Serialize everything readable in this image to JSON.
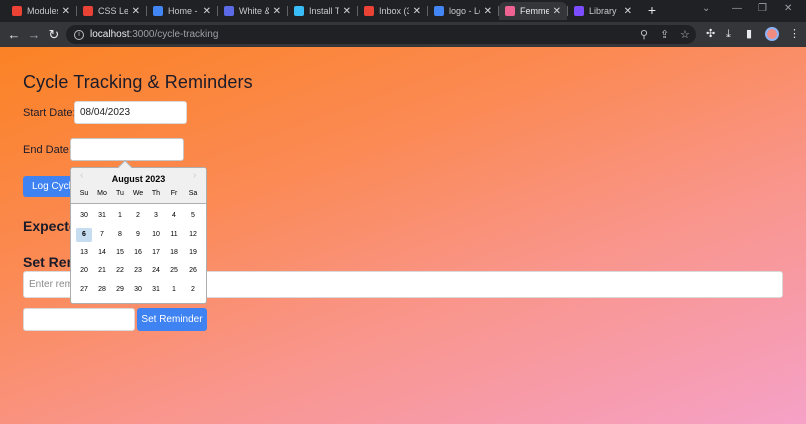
{
  "browser": {
    "tabs": [
      {
        "label": "Modules",
        "favicon": "gmail-m-icon",
        "color": "#ea4335",
        "active": false
      },
      {
        "label": "CSS Lea",
        "favicon": "gmail-m-icon",
        "color": "#ea4335",
        "active": false
      },
      {
        "label": "Home - ",
        "favicon": "globe-icon",
        "color": "#4285f4",
        "active": false
      },
      {
        "label": "White &",
        "favicon": "page-icon",
        "color": "#5b6be8",
        "active": false
      },
      {
        "label": "Install Ta",
        "favicon": "tailwind-icon",
        "color": "#38bdf8",
        "active": false
      },
      {
        "label": "Inbox (3",
        "favicon": "gmail-m-icon",
        "color": "#ea4335",
        "active": false
      },
      {
        "label": "logo - Lo",
        "favicon": "globe-icon",
        "color": "#4285f4",
        "active": false
      },
      {
        "label": "Femme",
        "favicon": "react-icon",
        "color": "#f06292",
        "active": true
      },
      {
        "label": "Library",
        "favicon": "globe-icon",
        "color": "#7c4dff",
        "active": false
      }
    ],
    "url_host": "localhost",
    "url_path": ":3000/cycle-tracking"
  },
  "page": {
    "title": "Cycle Tracking & Reminders",
    "start_label": "Start Date:",
    "start_value": "08/04/2023",
    "end_label": "End Date:",
    "end_value": "",
    "log_button": "Log Cycle",
    "expected_title": "Expected",
    "reminder_title": "Set Rem",
    "reminder_placeholder": "Enter remi",
    "reminder_date_value": "",
    "set_reminder_button": "Set Reminder"
  },
  "datepicker": {
    "month": "August 2023",
    "weekdays": [
      "Su",
      "Mo",
      "Tu",
      "We",
      "Th",
      "Fr",
      "Sa"
    ],
    "weeks": [
      [
        "30",
        "31",
        "1",
        "2",
        "3",
        "4",
        "5"
      ],
      [
        "6",
        "7",
        "8",
        "9",
        "10",
        "11",
        "12"
      ],
      [
        "13",
        "14",
        "15",
        "16",
        "17",
        "18",
        "19"
      ],
      [
        "20",
        "21",
        "22",
        "23",
        "24",
        "25",
        "26"
      ],
      [
        "27",
        "28",
        "29",
        "30",
        "31",
        "1",
        "2"
      ]
    ],
    "today": "6"
  }
}
